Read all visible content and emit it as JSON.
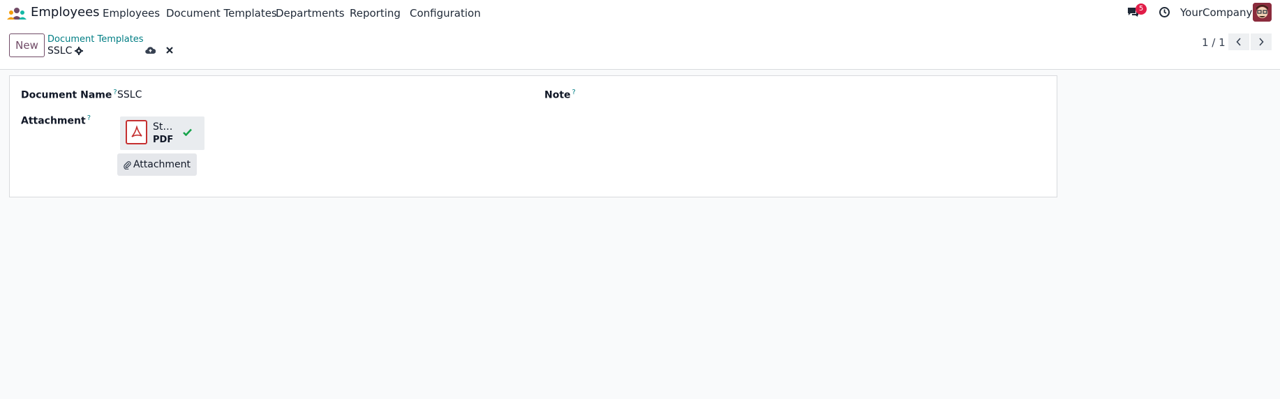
{
  "navbar": {
    "app_name": "Employees",
    "menu": [
      "Employees",
      "Document Templates",
      "Departments",
      "Reporting",
      "Configuration"
    ],
    "messages_badge": "5",
    "company": "YourCompany"
  },
  "control_panel": {
    "new_label": "New",
    "breadcrumb": "Document Templates",
    "record_title": "SSLC",
    "pager": "1 / 1"
  },
  "form": {
    "document_name_label": "Document Name",
    "document_name_value": "SSLC",
    "note_label": "Note",
    "attachment_label": "Attachment",
    "help_mark": "?",
    "attachment": {
      "name": "St…",
      "type": "PDF"
    },
    "attach_button": "Attachment"
  },
  "colors": {
    "brand": "#714b67",
    "link": "#017e84",
    "badge": "#e11d48",
    "pdf": "#c53030",
    "success": "#16a34a"
  }
}
